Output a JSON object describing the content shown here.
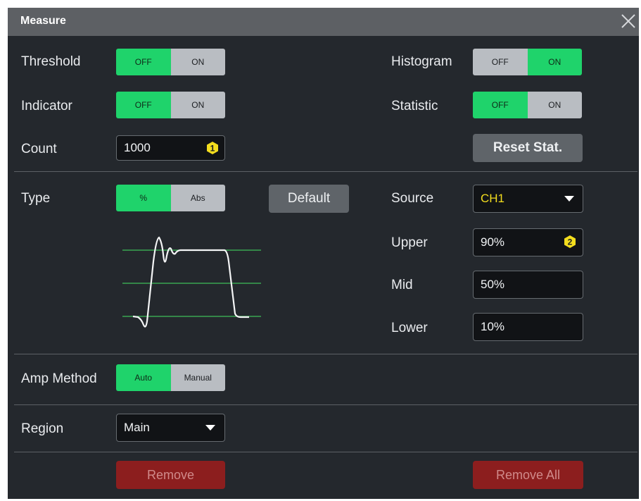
{
  "window": {
    "title": "Measure"
  },
  "threshold": {
    "label": "Threshold",
    "off": "OFF",
    "on": "ON",
    "state": "OFF"
  },
  "histogram": {
    "label": "Histogram",
    "off": "OFF",
    "on": "ON",
    "state": "ON"
  },
  "indicator": {
    "label": "Indicator",
    "off": "OFF",
    "on": "ON",
    "state": "OFF"
  },
  "statistic": {
    "label": "Statistic",
    "off": "OFF",
    "on": "ON",
    "state": "OFF"
  },
  "count": {
    "label": "Count",
    "value": "1000",
    "badge": "1"
  },
  "reset_stat": {
    "label": "Reset Stat."
  },
  "type": {
    "label": "Type",
    "pct": "%",
    "abs": "Abs",
    "state": "%"
  },
  "default_button": {
    "label": "Default"
  },
  "source": {
    "label": "Source",
    "value": "CH1"
  },
  "upper": {
    "label": "Upper",
    "value": "90%",
    "badge": "2"
  },
  "mid": {
    "label": "Mid",
    "value": "50%"
  },
  "lower": {
    "label": "Lower",
    "value": "10%"
  },
  "amp_method": {
    "label": "Amp Method",
    "auto": "Auto",
    "manual": "Manual",
    "state": "Auto"
  },
  "region": {
    "label": "Region",
    "value": "Main"
  },
  "remove": {
    "label": "Remove"
  },
  "remove_all": {
    "label": "Remove All"
  },
  "colors": {
    "active": "#1fd36b",
    "inactive": "#b9bdc2",
    "badge": "#f3dd1e",
    "source_text": "#f3dd1e",
    "remove": "#8c1e1e"
  }
}
